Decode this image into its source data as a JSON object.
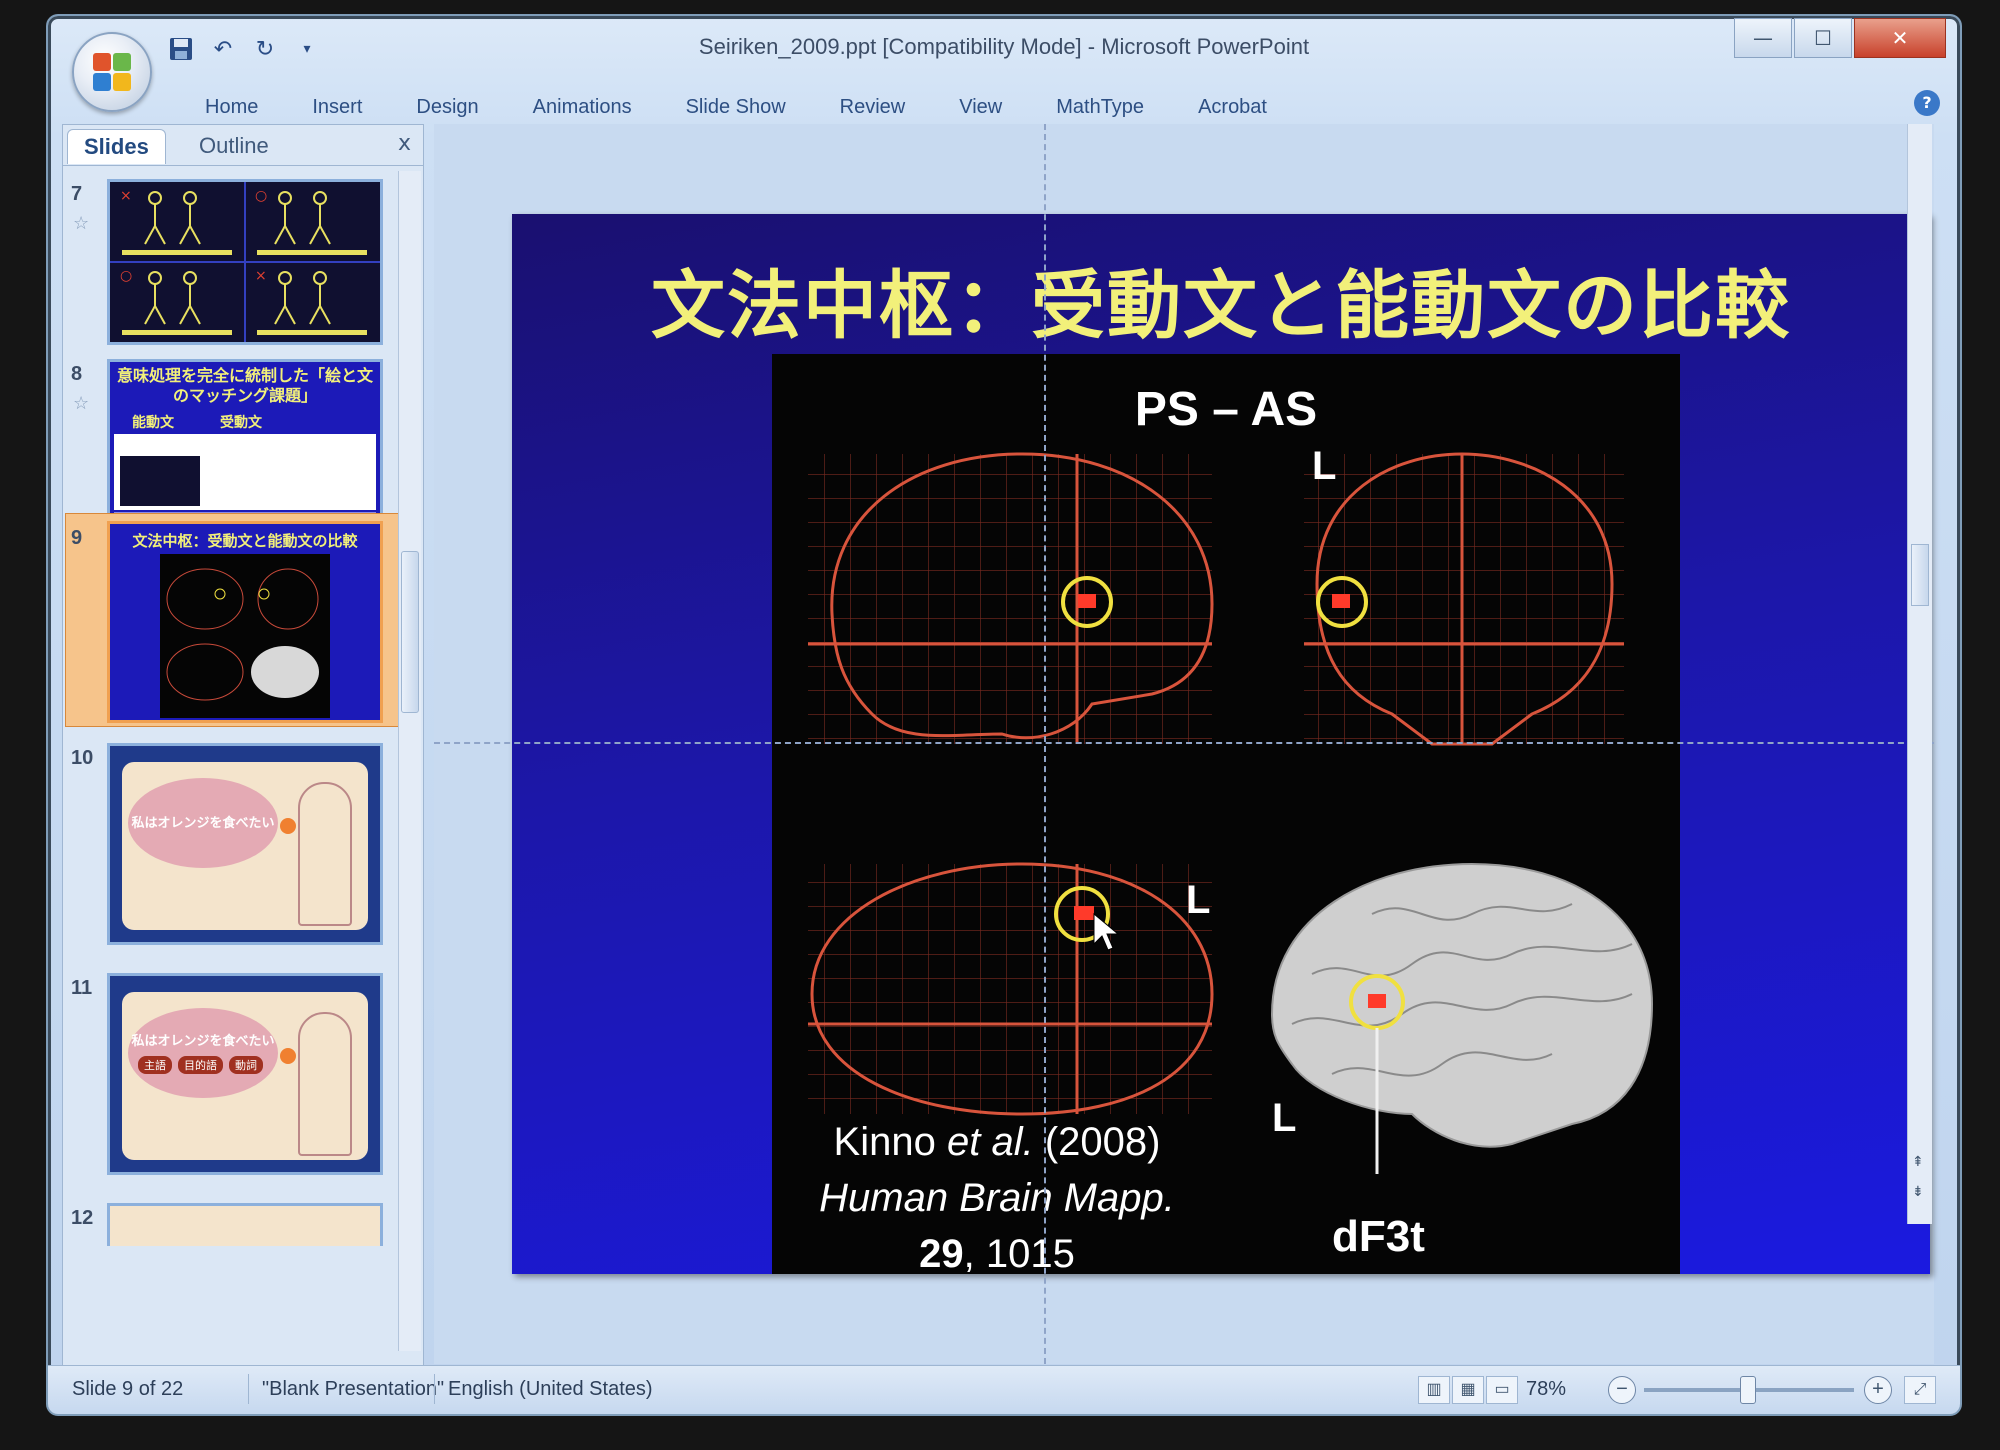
{
  "window": {
    "title": "Seiriken_2009.ppt [Compatibility Mode] - Microsoft PowerPoint",
    "controls": {
      "minimize": "—",
      "maximize": "☐",
      "close": "✕"
    }
  },
  "ribbon": {
    "tabs": [
      "Home",
      "Insert",
      "Design",
      "Animations",
      "Slide Show",
      "Review",
      "View",
      "MathType",
      "Acrobat"
    ]
  },
  "slides_pane": {
    "tabs": {
      "slides": "Slides",
      "outline": "Outline"
    },
    "close": "x",
    "thumbnails": [
      {
        "number": "7"
      },
      {
        "number": "8",
        "title": "意味処理を完全に統制した「絵と文のマッチング課題」",
        "col1": "能動文",
        "col2": "受動文"
      },
      {
        "number": "9",
        "title": "文法中枢：受動文と能動文の比較"
      },
      {
        "number": "10",
        "bubble": "私はオレンジを食べたい"
      },
      {
        "number": "11",
        "bubble": "私はオレンジを食べたい",
        "chips": [
          "主語",
          "目的語",
          "動詞"
        ]
      },
      {
        "number": "12"
      }
    ]
  },
  "slide": {
    "title": "文法中枢：受動文と能動文の比較",
    "figure": {
      "contrast": "PS – AS",
      "left_label": "L",
      "citation": {
        "authors": "Kinno",
        "et_al": "et al.",
        "year": "(2008)",
        "journal": "Human Brain Mapp.",
        "volume": "29",
        "page": ", 1015"
      },
      "region_label": "dF3t"
    }
  },
  "statusbar": {
    "slide_info": "Slide 9 of 22",
    "theme": "\"Blank Presentation\"",
    "language": "English (United States)",
    "zoom": "78%"
  },
  "colors": {
    "title_yellow": "#f2f07a",
    "slide_blue": "#1b1ae0",
    "glass_red": "#d8543c",
    "circle_yellow": "#f0e040"
  }
}
